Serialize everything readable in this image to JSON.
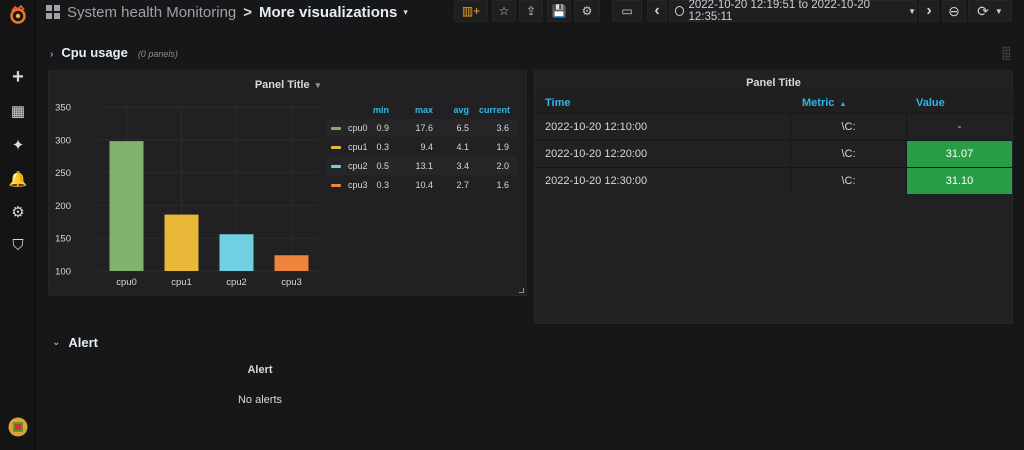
{
  "app": {
    "logo": "grafana-logo"
  },
  "breadcrumb": {
    "folder": "System health Monitoring",
    "separator": ">",
    "title": "More visualizations",
    "caret": "▾"
  },
  "toolbar": {
    "buttons": [
      {
        "name": "add-panel-button",
        "icon": "add-panel-icon",
        "glyph": "▥+"
      },
      {
        "name": "star-button",
        "icon": "star-icon",
        "glyph": "☆"
      },
      {
        "name": "share-button",
        "icon": "share-icon",
        "glyph": "⇪"
      },
      {
        "name": "save-button",
        "icon": "save-icon",
        "glyph": "💾"
      },
      {
        "name": "settings-button",
        "icon": "gear-icon",
        "glyph": "⚙"
      },
      {
        "name": "tv-mode-button",
        "icon": "monitor-icon",
        "glyph": "▭"
      }
    ],
    "time_prev": "‹",
    "time_range": "2022-10-20 12:19:51 to 2022-10-20 12:35:11",
    "time_next": "›",
    "zoom_out": "⊖",
    "refresh": "⟳"
  },
  "sidebar": [
    {
      "name": "sidebar-item-create",
      "icon": "plus-icon",
      "glyph": "+"
    },
    {
      "name": "sidebar-item-dashboards",
      "icon": "dashboards-icon",
      "glyph": "▦"
    },
    {
      "name": "sidebar-item-explore",
      "icon": "compass-icon",
      "glyph": "✦"
    },
    {
      "name": "sidebar-item-alerting",
      "icon": "bell-icon",
      "glyph": "🔔"
    },
    {
      "name": "sidebar-item-configuration",
      "icon": "gear-icon",
      "glyph": "⚙"
    },
    {
      "name": "sidebar-item-server-admin",
      "icon": "shield-icon",
      "glyph": "⛉"
    }
  ],
  "row_cpu": {
    "chevron": "›",
    "title": "Cpu usage",
    "subtitle": "(0 panels)"
  },
  "bar_panel": {
    "title": "Panel Title",
    "caret": "▾",
    "legend_headers": [
      "min",
      "max",
      "avg",
      "current"
    ],
    "legend": [
      {
        "name": "cpu0",
        "color": "#7eb26d",
        "min": "0.9",
        "max": "17.6",
        "avg": "6.5",
        "current": "3.6"
      },
      {
        "name": "cpu1",
        "color": "#eab839",
        "min": "0.3",
        "max": "9.4",
        "avg": "4.1",
        "current": "1.9"
      },
      {
        "name": "cpu2",
        "color": "#6ed0e0",
        "min": "0.5",
        "max": "13.1",
        "avg": "3.4",
        "current": "2.0"
      },
      {
        "name": "cpu3",
        "color": "#ef843c",
        "min": "0.3",
        "max": "10.4",
        "avg": "2.7",
        "current": "1.6"
      }
    ]
  },
  "chart_data": {
    "type": "bar",
    "title": "Panel Title",
    "categories": [
      "cpu0",
      "cpu1",
      "cpu2",
      "cpu3"
    ],
    "values": [
      298,
      186,
      156,
      124
    ],
    "colors": [
      "#7eb26d",
      "#eab839",
      "#6ed0e0",
      "#ef843c"
    ],
    "ylim": [
      100,
      350
    ],
    "yticks": [
      "100",
      "150",
      "200",
      "250",
      "300",
      "350"
    ],
    "ytick_values": [
      100,
      150,
      200,
      250,
      300,
      350
    ],
    "grid": true
  },
  "table_panel": {
    "title": "Panel Title",
    "headers": {
      "time": "Time",
      "metric": "Metric",
      "metric_sort": "▲",
      "value": "Value"
    },
    "rows": [
      {
        "time": "2022-10-20 12:10:00",
        "metric": "\\C:",
        "value": "-",
        "status": "none"
      },
      {
        "time": "2022-10-20 12:20:00",
        "metric": "\\C:",
        "value": "31.07",
        "status": "ok"
      },
      {
        "time": "2022-10-20 12:30:00",
        "metric": "\\C:",
        "value": "31.10",
        "status": "ok"
      }
    ],
    "ok_color": "#299c46"
  },
  "row_alert": {
    "chevron": "⌄",
    "title": "Alert"
  },
  "alert_panel": {
    "title": "Alert",
    "empty_text": "No alerts"
  },
  "user": {
    "avatar": "user-avatar"
  }
}
